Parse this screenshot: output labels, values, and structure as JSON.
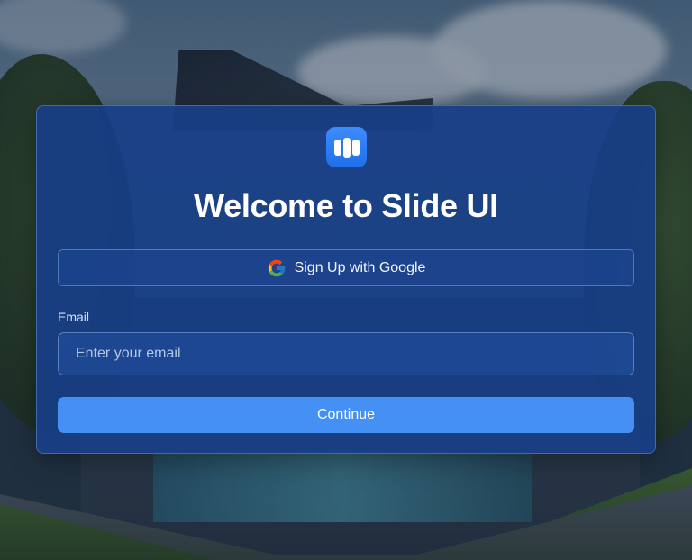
{
  "app": {
    "title": "Welcome to Slide UI",
    "logo_icon": "slide-ui-logo-icon",
    "accent_color": "#4590f5"
  },
  "signup": {
    "google_button_label": "Sign Up with Google",
    "google_icon": "google-icon"
  },
  "email": {
    "label": "Email",
    "placeholder": "Enter your email",
    "value": ""
  },
  "actions": {
    "continue_label": "Continue"
  }
}
